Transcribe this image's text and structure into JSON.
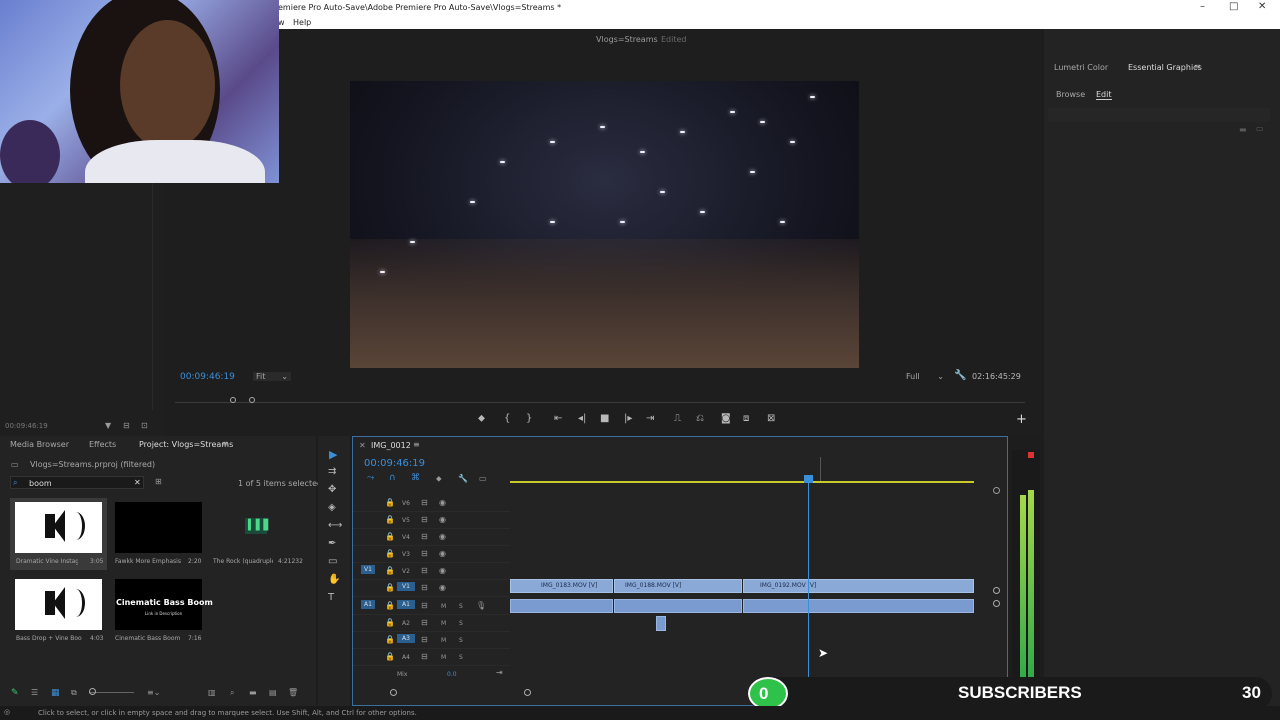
{
  "window": {
    "title": "emiere Pro Auto-Save\\Adobe Premiere Pro Auto-Save\\Vlogs=Streams *",
    "controls": [
      "–",
      "□",
      "✕"
    ]
  },
  "menu": {
    "items": [
      "w",
      "Help"
    ]
  },
  "program": {
    "sequence_name": "Vlogs=Streams",
    "status": "Edited",
    "timecode_left": "00:09:46:19",
    "fit": "Fit",
    "quality": "Full",
    "timecode_right": "02:16:45:29"
  },
  "source": {
    "timecode": "00:09:46:19"
  },
  "right_panel": {
    "tabs": [
      "Lumetri Color",
      "Essential Graphics"
    ],
    "subtabs": [
      "Browse",
      "Edit"
    ]
  },
  "project": {
    "tabs": [
      "Media Browser",
      "Effects",
      "Project: Vlogs=Streams"
    ],
    "filename": "Vlogs=Streams.prproj (filtered)",
    "search_value": "boom",
    "items_selected": "1 of 5 items selected",
    "items": [
      {
        "name": "Dramatic Vine Instagra...",
        "duration": "3:05"
      },
      {
        "name": "Fawkk More Emphasis...",
        "duration": "2:20"
      },
      {
        "name": "The Rock (quadruple...",
        "duration": "4:21232"
      },
      {
        "name": "Bass Drop + Vine Boom...",
        "duration": "4:03"
      },
      {
        "name": "Cinematic Bass Boom ...",
        "duration": "7:16"
      }
    ],
    "thumb_title": "Cinematic Bass Boom",
    "thumb_subtitle": "Link in Description"
  },
  "timeline": {
    "tab": "IMG_0012",
    "timecode": "00:09:46:19",
    "video_tracks": [
      "V6",
      "V5",
      "V4",
      "V3",
      "V2",
      "V1"
    ],
    "audio_tracks": [
      "A1",
      "A2",
      "A3",
      "A4"
    ],
    "source_v": "V1",
    "source_a": "A1",
    "mix_label": "Mix",
    "mix_value": "0.0",
    "clips": [
      {
        "name": "IMG_0183.MOV [V]"
      },
      {
        "name": "IMG_0188.MOV [V]"
      },
      {
        "name": "IMG_0192.MOV [V]"
      }
    ]
  },
  "status_bar": {
    "text": "Click to select, or click in empty space and drag to marquee select. Use Shift, Alt, and Ctrl for other options."
  },
  "overlay": {
    "subscribers_label": "SUBSCRIBERS",
    "subscribers_count": "30",
    "progress_value": "0"
  },
  "colors": {
    "accent_blue": "#3a8fd9",
    "clip_blue": "#8aa9d6",
    "subscriber_green": "#2ec24a"
  }
}
